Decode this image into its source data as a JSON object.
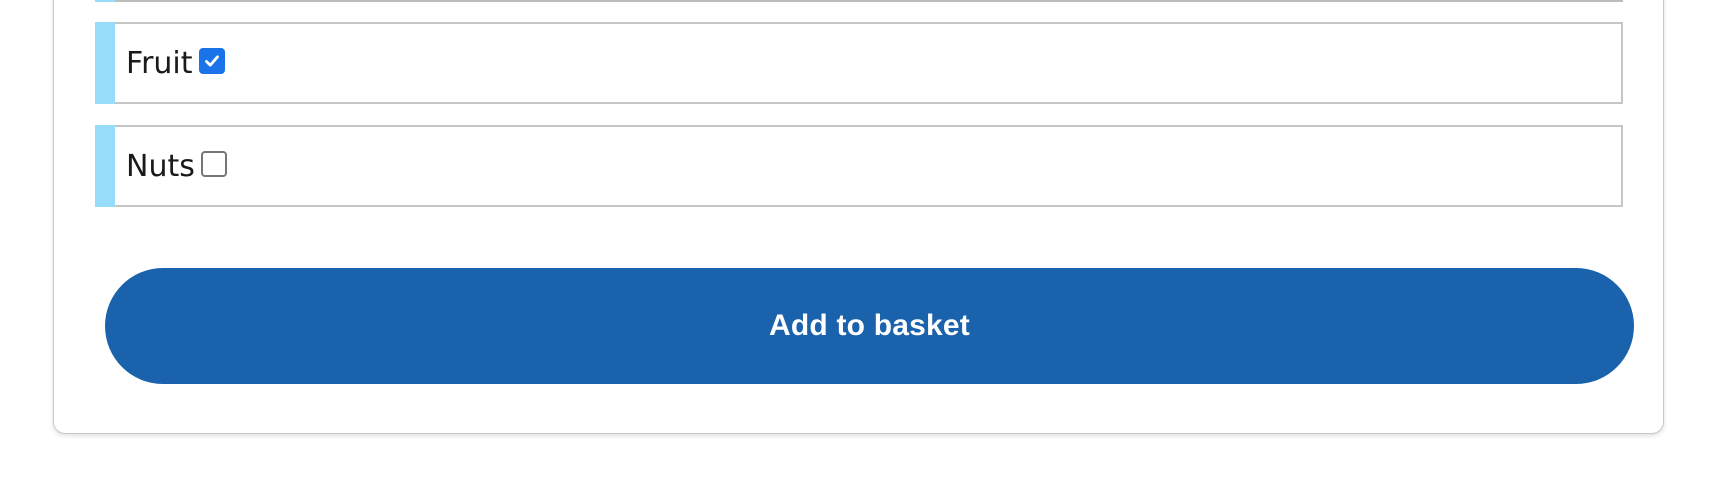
{
  "options": [
    {
      "label": "Fruit",
      "checked": true
    },
    {
      "label": "Nuts",
      "checked": false
    }
  ],
  "actions": {
    "add_to_basket_label": "Add to basket"
  },
  "colors": {
    "accent_bar": "#97dcf8",
    "button_bg": "#1a62ab",
    "button_text": "#ffffff",
    "checkbox_checked": "#1a73e8"
  },
  "icons": {
    "checked": "checkmark-icon"
  }
}
